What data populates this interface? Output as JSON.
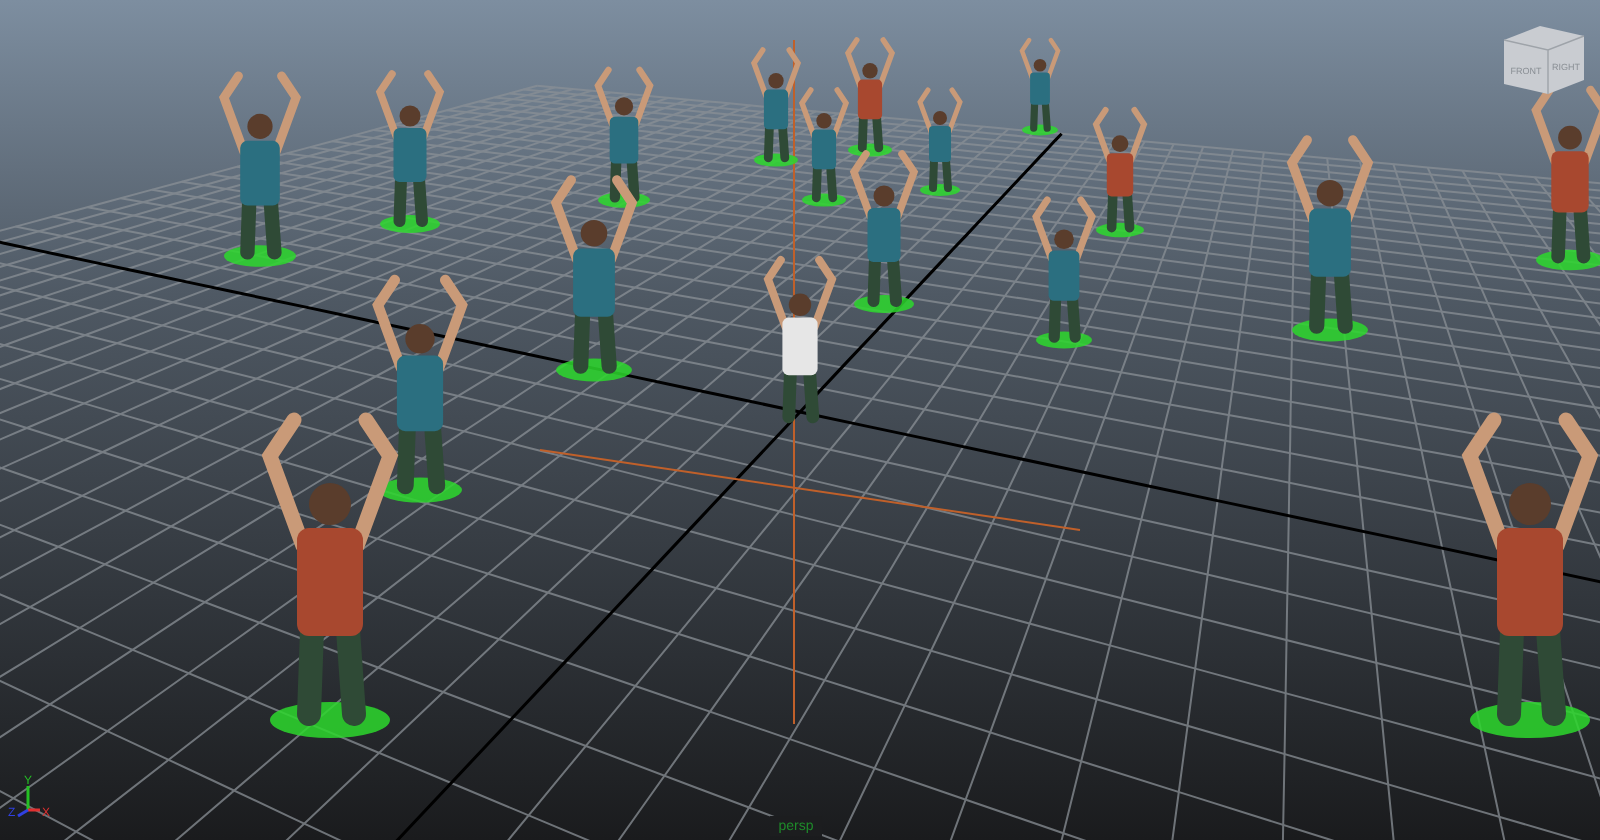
{
  "viewport": {
    "camera_label": "persp",
    "view_cube": {
      "faces": [
        "FRONT",
        "RIGHT"
      ]
    },
    "axis_gizmo": [
      "X",
      "Y",
      "Z"
    ],
    "characters": [
      {
        "color": "#2b6f80"
      },
      {
        "color": "#2b6f80"
      },
      {
        "color": "#2b6f80"
      },
      {
        "color": "#2b6f80"
      },
      {
        "color": "#a8482f"
      },
      {
        "color": "#2b6f80"
      },
      {
        "color": "#2b6f80"
      },
      {
        "color": "#2b6f80"
      },
      {
        "color": "#2b6f80"
      },
      {
        "color": "#a8482f"
      },
      {
        "color": "#2b6f80"
      },
      {
        "color": "#2b6f80"
      },
      {
        "color": "#a8482f"
      },
      {
        "color": "#2b6f80"
      },
      {
        "color": "#2b6f80"
      },
      {
        "color": "#a8482f"
      },
      {
        "color": "#a8482f"
      },
      {
        "color": "#e6e6e6"
      }
    ]
  }
}
